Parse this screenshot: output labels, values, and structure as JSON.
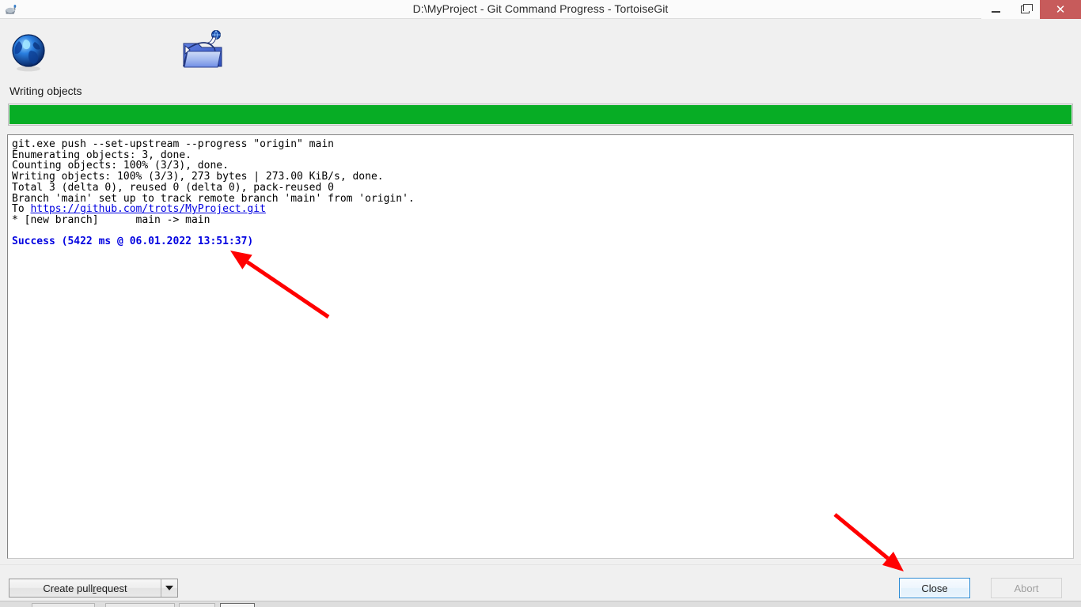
{
  "window": {
    "title": "D:\\MyProject - Git Command Progress - TortoiseGit",
    "app_icon": "tortoisegit-icon",
    "controls": {
      "minimize_label": "–",
      "maximize_label": "❐",
      "close_label": "✕"
    }
  },
  "status": {
    "label": "Writing objects",
    "icon_left": "globe-icon",
    "icon_right": "folder-push-icon"
  },
  "progress": {
    "percent": 100,
    "color": "#07ad25"
  },
  "log": {
    "lines": [
      {
        "text": "git.exe push --set-upstream --progress \"origin\" main",
        "style": "plain"
      },
      {
        "text": "Enumerating objects: 3, done.",
        "style": "plain"
      },
      {
        "text": "Counting objects: 100% (3/3), done.",
        "style": "plain"
      },
      {
        "text": "Writing objects: 100% (3/3), 273 bytes | 273.00 KiB/s, done.",
        "style": "plain"
      },
      {
        "text": "Total 3 (delta 0), reused 0 (delta 0), pack-reused 0",
        "style": "plain"
      },
      {
        "text": "Branch 'main' set up to track remote branch 'main' from 'origin'.",
        "style": "plain"
      },
      {
        "prefix": "To ",
        "link": "https://github.com/trots/MyProject.git",
        "style": "link"
      },
      {
        "text": "* [new branch]      main -> main",
        "style": "plain"
      },
      {
        "text": "",
        "style": "blank"
      },
      {
        "text": "Success (5422 ms @ 06.01.2022 13:51:37)",
        "style": "success"
      }
    ]
  },
  "buttons": {
    "create_pull_request": {
      "label_before": "Create pull ",
      "label_accel": "r",
      "label_after": "equest"
    },
    "close": "Close",
    "abort": "Abort"
  },
  "annotations": {
    "arrow_color": "#ff0000",
    "arrow_success_target": "Success (5422 ms @ 06.01.2022 13:51:37)",
    "arrow_close_target": "Close"
  }
}
